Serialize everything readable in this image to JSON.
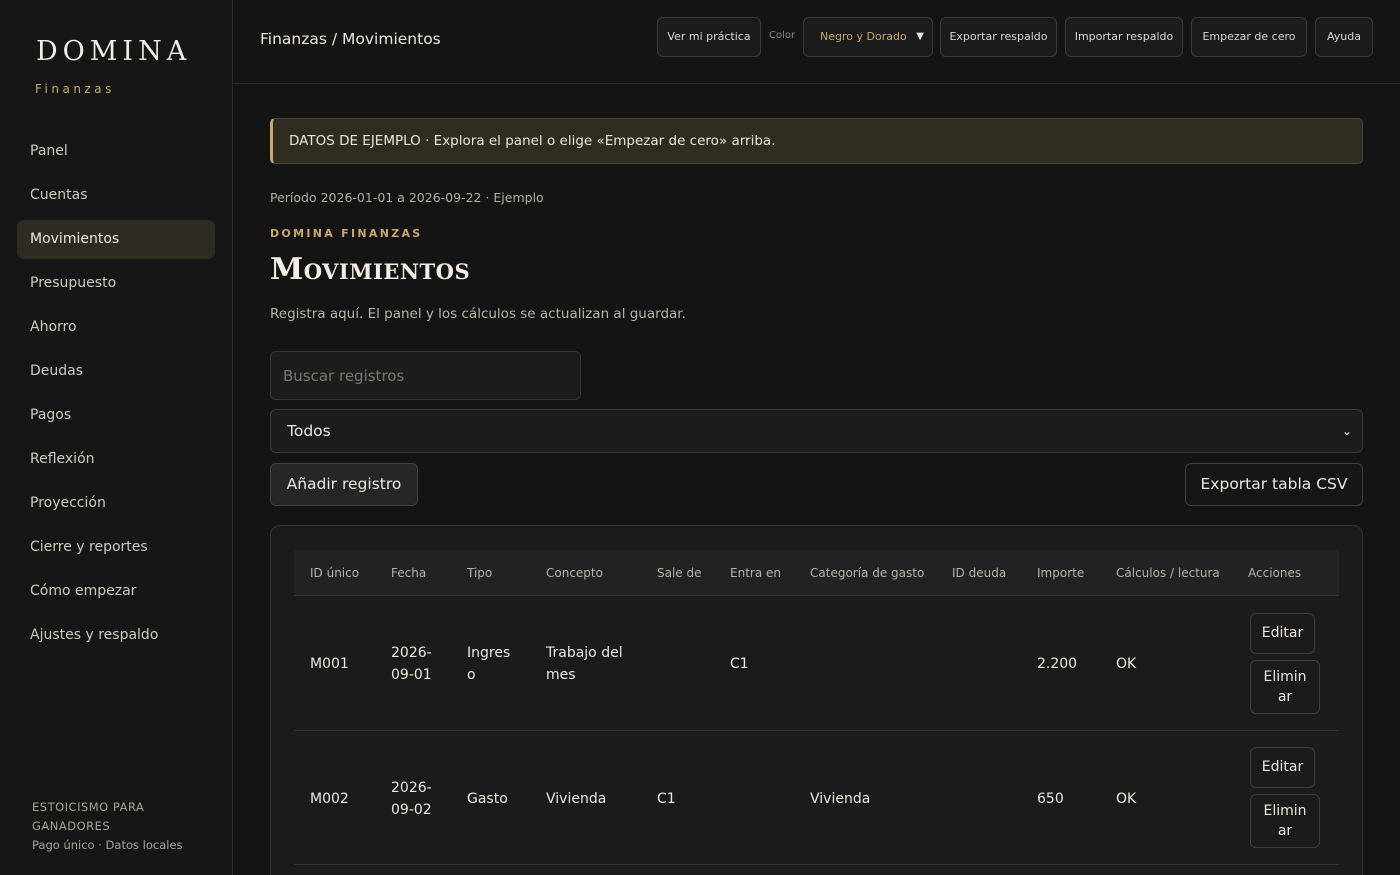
{
  "sidebar": {
    "brand": "DOMINA",
    "brand_sub": "Finanzas",
    "items": [
      {
        "label": "Panel"
      },
      {
        "label": "Cuentas"
      },
      {
        "label": "Movimientos"
      },
      {
        "label": "Presupuesto"
      },
      {
        "label": "Ahorro"
      },
      {
        "label": "Deudas"
      },
      {
        "label": "Pagos"
      },
      {
        "label": "Reflexión"
      },
      {
        "label": "Proyección"
      },
      {
        "label": "Cierre y reportes"
      },
      {
        "label": "Cómo empezar"
      },
      {
        "label": "Ajustes y respaldo"
      }
    ],
    "active_item": "Movimientos",
    "footer_line1": "ESTOICISMO PARA",
    "footer_line2": "GANADORES",
    "footer_line3": "Pago único · Datos locales"
  },
  "topbar": {
    "breadcrumb": "Finanzas / Movimientos",
    "practice_label": "Ver mi práctica",
    "color_label": "Color",
    "color_value": "Negro y Dorado",
    "export_label": "Exportar respaldo",
    "import_label": "Importar respaldo",
    "reset_label": "Empezar de cero",
    "help_label": "Ayuda"
  },
  "main": {
    "banner": "DATOS DE EJEMPLO · Explora el panel o elige «Empezar de cero» arriba.",
    "period": "Período 2026-01-01 a 2026-09-22 · Ejemplo",
    "eyebrow": "DOMINA FINANZAS",
    "title": "Movimientos",
    "description": "Registra aquí. El panel y los cálculos se actualizan al guardar.",
    "search_placeholder": "Buscar registros",
    "filter_value": "Todos",
    "add_label": "Añadir registro",
    "csv_label": "Exportar tabla CSV"
  },
  "table": {
    "headers": [
      "ID único",
      "Fecha",
      "Tipo",
      "Concepto",
      "Sale de",
      "Entra en",
      "Categoría de gasto",
      "ID deuda",
      "Importe",
      "Cálculos / lectura",
      "Acciones"
    ],
    "rows": [
      {
        "id": "M001",
        "date": "2026-\n09-01",
        "type": "Ingres\no",
        "concept": "Trabajo del\nmes",
        "from": "",
        "to": "C1",
        "category": "",
        "debt_id": "",
        "amount": "2.200",
        "calc": "OK"
      },
      {
        "id": "M002",
        "date": "2026-\n09-02",
        "type": "Gasto",
        "concept": "Vivienda",
        "from": "C1",
        "to": "",
        "category": "Vivienda",
        "debt_id": "",
        "amount": "650",
        "calc": "OK"
      }
    ],
    "edit_label": "Editar",
    "delete_label": "Elimin\nar"
  },
  "colors": {
    "accent": "#c9a868",
    "background": "#141414",
    "sidebar_active": "#2e2b22"
  }
}
